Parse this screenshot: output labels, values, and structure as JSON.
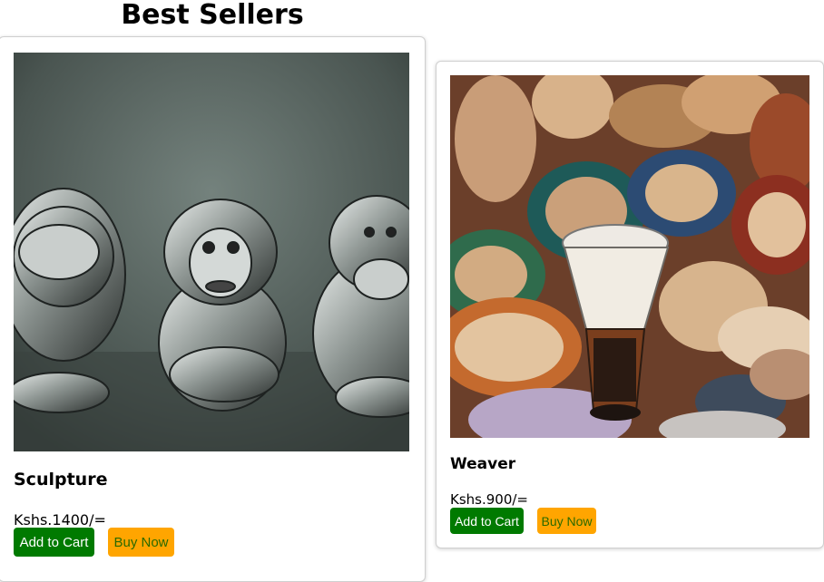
{
  "page": {
    "title": "Best Sellers"
  },
  "products": [
    {
      "name": "Sculpture",
      "price": "Kshs.1400/=",
      "add_to_cart_label": "Add to Cart",
      "buy_now_label": "Buy Now",
      "image": "three-wise-monkeys-sculpture"
    },
    {
      "name": "Weaver",
      "price": "Kshs.900/=",
      "add_to_cart_label": "Add to Cart",
      "buy_now_label": "Buy Now",
      "image": "woven-baskets-and-drum"
    }
  ],
  "colors": {
    "add_to_cart_bg": "#007a00",
    "buy_now_bg": "#ffa500",
    "buy_now_text": "#2a6a00"
  }
}
